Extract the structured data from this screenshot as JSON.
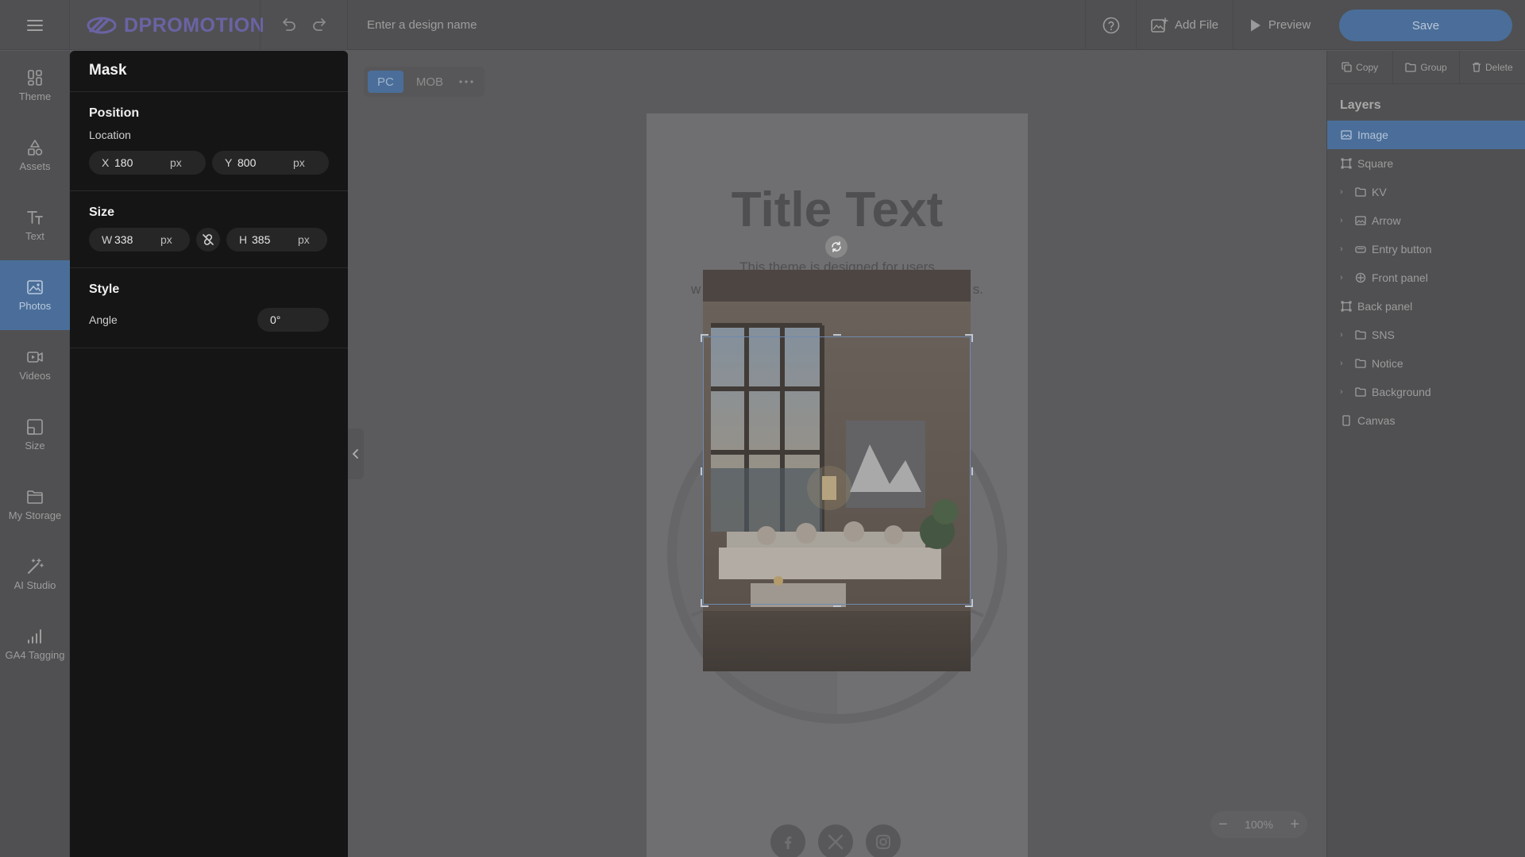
{
  "app": {
    "logo_text": "DPROMOTION",
    "design_name_placeholder": "Enter a design name",
    "add_file_label": "Add File",
    "preview_label": "Preview",
    "save_label": "Save"
  },
  "nav": {
    "items": [
      {
        "label": "Theme",
        "icon": "theme-icon"
      },
      {
        "label": "Assets",
        "icon": "assets-icon"
      },
      {
        "label": "Text",
        "icon": "text-icon"
      },
      {
        "label": "Photos",
        "icon": "photos-icon",
        "active": true
      },
      {
        "label": "Videos",
        "icon": "videos-icon"
      },
      {
        "label": "Size",
        "icon": "size-icon"
      },
      {
        "label": "My Storage",
        "icon": "folder-icon"
      },
      {
        "label": "AI Studio",
        "icon": "magic-wand-icon"
      },
      {
        "label": "GA4 Tagging",
        "icon": "bar-chart-icon"
      }
    ]
  },
  "mask": {
    "title": "Mask",
    "position": {
      "title": "Position",
      "location_label": "Location",
      "x_label": "X",
      "x_value": "180",
      "y_label": "Y",
      "y_value": "800",
      "unit": "px"
    },
    "size": {
      "title": "Size",
      "w_label": "W",
      "w_value": "338",
      "h_label": "H",
      "h_value": "385",
      "unit": "px"
    },
    "style": {
      "title": "Style",
      "angle_label": "Angle",
      "angle_value": "0°"
    }
  },
  "device": {
    "tabs": [
      "PC",
      "MOB"
    ],
    "active": "PC"
  },
  "canvas": {
    "title": "Title Text",
    "desc_line1": "This theme is designed for users",
    "desc_line2_start": "w",
    "desc_line2_end": "s."
  },
  "zoom": {
    "value": "100%"
  },
  "right": {
    "actions": [
      "Copy",
      "Group",
      "Delete"
    ],
    "layers_title": "Layers",
    "layers": [
      {
        "label": "Image",
        "icon": "image-icon",
        "expandable": false,
        "active": true
      },
      {
        "label": "Square",
        "icon": "square-icon",
        "expandable": false
      },
      {
        "label": "KV",
        "icon": "folder-icon",
        "expandable": true
      },
      {
        "label": "Arrow",
        "icon": "image-icon",
        "expandable": true
      },
      {
        "label": "Entry button",
        "icon": "button-icon",
        "expandable": true
      },
      {
        "label": "Front panel",
        "icon": "component-icon",
        "expandable": true
      },
      {
        "label": "Back panel",
        "icon": "square-icon",
        "expandable": false
      },
      {
        "label": "SNS",
        "icon": "folder-icon",
        "expandable": true
      },
      {
        "label": "Notice",
        "icon": "folder-icon",
        "expandable": true
      },
      {
        "label": "Background",
        "icon": "folder-icon",
        "expandable": true
      },
      {
        "label": "Canvas",
        "icon": "canvas-icon",
        "expandable": false
      }
    ]
  },
  "colors": {
    "accent": "#4a6e99",
    "panel_bg": "#151515",
    "workspace_bg": "#5b5b5d"
  }
}
